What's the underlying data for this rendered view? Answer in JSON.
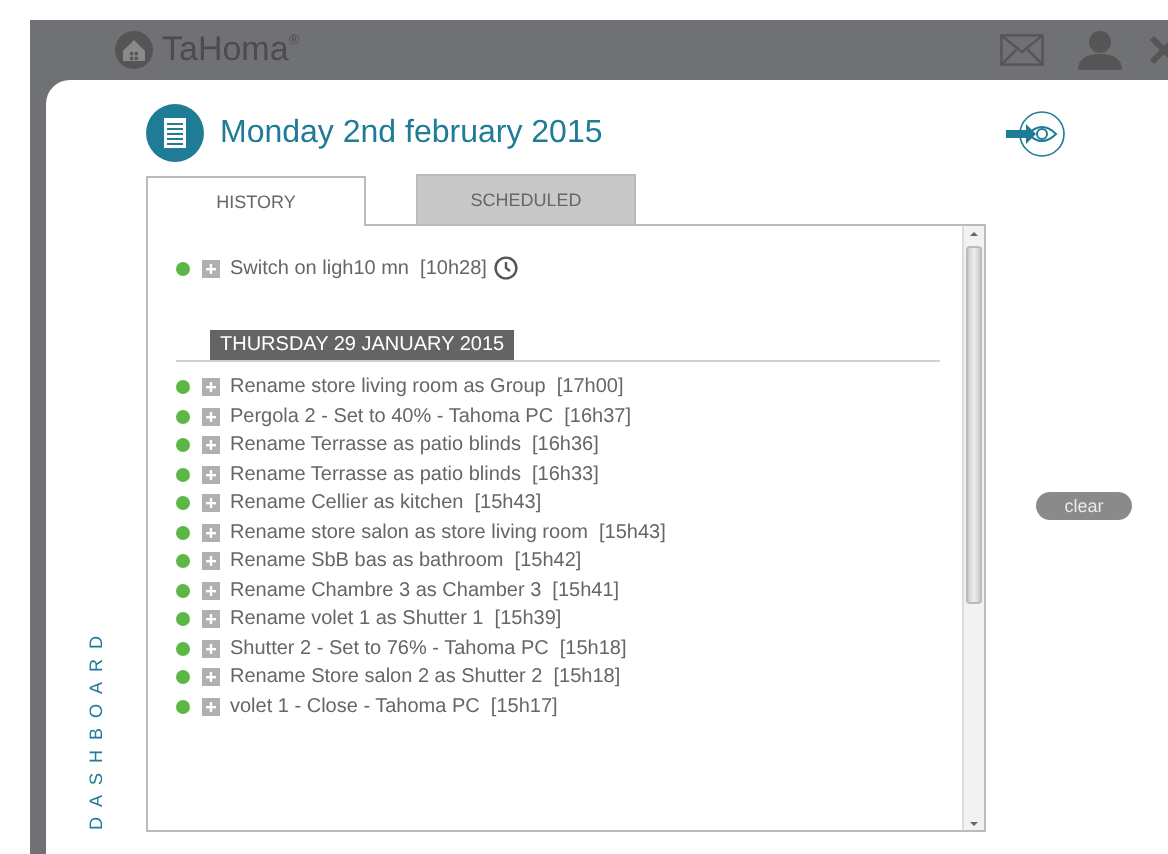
{
  "app": {
    "name": "TaHoma",
    "mark": "®"
  },
  "page": {
    "title": "Monday 2nd february 2015"
  },
  "tabs": [
    {
      "label": "HISTORY",
      "selected": true
    },
    {
      "label": "SCHEDULED",
      "selected": false
    }
  ],
  "history": {
    "entries": [
      {
        "text": "Switch on ligh10 mn",
        "time": "[10h28]",
        "expanded": false,
        "timer": true
      }
    ],
    "days": [
      {
        "label": "THURSDAY 29 JANUARY 2015",
        "entries": [
          {
            "text": "Rename store living room as Group",
            "time": "[17h00]",
            "expanded": false,
            "timer": false
          },
          {
            "text": "Pergola 2 - Set to 40% - Tahoma PC",
            "time": "[16h37]",
            "expanded": false,
            "timer": false
          },
          {
            "text": "Rename Terrasse as patio blinds",
            "time": "[16h36]",
            "expanded": false,
            "timer": false
          },
          {
            "text": "Rename Terrasse as patio blinds",
            "time": "[16h33]",
            "expanded": false,
            "timer": false
          },
          {
            "text": "Rename Cellier as kitchen",
            "time": "[15h43]",
            "expanded": false,
            "timer": false
          },
          {
            "text": "Rename store salon as store living room",
            "time": "[15h43]",
            "expanded": false,
            "timer": false
          },
          {
            "text": "Rename SbB bas as bathroom",
            "time": "[15h42]",
            "expanded": false,
            "timer": false
          },
          {
            "text": "Rename Chambre 3 as Chamber 3",
            "time": "[15h41]",
            "expanded": false,
            "timer": false
          },
          {
            "text": "Rename volet 1 as Shutter 1",
            "time": "[15h39]",
            "expanded": false,
            "timer": false
          },
          {
            "text": "Shutter 2 - Set to 76% - Tahoma PC",
            "time": "[15h18]",
            "expanded": false,
            "timer": false
          },
          {
            "text": "Rename Store salon 2 as Shutter 2",
            "time": "[15h18]",
            "expanded": false,
            "timer": false
          },
          {
            "text": "volet 1 - Close - Tahoma PC",
            "time": "[15h17]",
            "expanded": false,
            "timer": false
          }
        ]
      }
    ]
  },
  "clear_button": "clear",
  "sidebar": {
    "label": "DASHBOARD"
  }
}
